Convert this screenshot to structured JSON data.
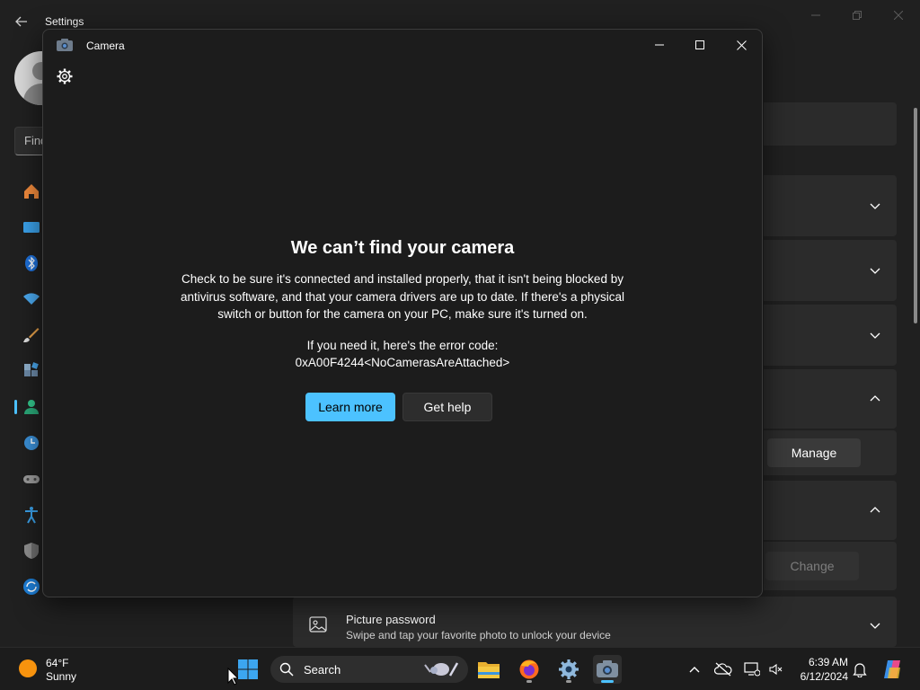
{
  "settings": {
    "title": "Settings",
    "search_partial": "Find",
    "buttons": {
      "manage": "Manage",
      "change": "Change"
    },
    "picture_password": {
      "title": "Picture password",
      "subtitle": "Swipe and tap your favorite photo to unlock your device"
    },
    "nav_icons": [
      "home-icon",
      "system-icon",
      "bluetooth-icon",
      "network-icon",
      "personalization-icon",
      "apps-icon",
      "accounts-icon",
      "time-language-icon",
      "gaming-icon",
      "accessibility-icon",
      "privacy-icon",
      "windows-update-icon"
    ]
  },
  "camera": {
    "title": "Camera",
    "error": {
      "title": "We can’t find your camera",
      "body": "Check to be sure it's connected and installed properly, that it isn't being blocked by antivirus software, and that your camera drivers are up to date. If there's a physical switch or button for the camera on your PC, make sure it's turned on.",
      "need_code": "If you need it, here's the error code:",
      "code": "0xA00F4244<NoCamerasAreAttached>"
    },
    "buttons": {
      "learn_more": "Learn more",
      "get_help": "Get help"
    }
  },
  "taskbar": {
    "weather": {
      "temp": "64°F",
      "condition": "Sunny"
    },
    "search_label": "Search",
    "apps": [
      "start-icon",
      "file-explorer-icon",
      "firefox-icon",
      "settings-icon",
      "camera-icon"
    ],
    "tray": {
      "time": "6:39 AM",
      "date": "6/12/2024"
    }
  },
  "colors": {
    "accent": "#4cc2ff",
    "window_bg": "#1c1c1c",
    "settings_bg": "#202020",
    "card_bg": "#2b2b2b"
  }
}
